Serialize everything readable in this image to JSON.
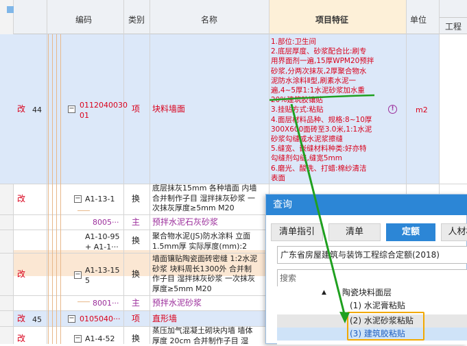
{
  "headers": {
    "code": "编码",
    "category": "类别",
    "name": "名称",
    "features": "项目特征",
    "unit": "单位",
    "engineering": "工程"
  },
  "row44": {
    "status": "改",
    "number": "44",
    "code": "011204003001",
    "code_line1": "0112040030",
    "code_line2": "01",
    "category": "项",
    "name": "块料墙面",
    "unit": "m2",
    "features": [
      "1.部位:卫生间",
      "2.底层厚度、砂浆配合比:刷专",
      "用界面剂一遍,15厚WPM20预拌",
      "砂浆,分两次抹灰,2厚聚合物水",
      "泥防水涂料Ⅱ型,刷素水泥一",
      "遍,4~5厚1:1水泥砂浆加水重",
      "20%建筑胶镶贴",
      "3.挂贴方式:粘贴",
      "4.面层材料品种、规格:8~10厚",
      "300X600面砖至3.0米,1:1水泥",
      "砂浆勾缝或水泥浆擦缝",
      "5.缝宽、嵌缝材料种类:好亦特",
      "勾缝剂勾缝,缝宽5mm",
      "6.磨光、酸洗、打蜡:棉纱清洁",
      "表面"
    ]
  },
  "sub1": {
    "status": "改",
    "code": "A1-13-1",
    "category": "换",
    "name_lines": [
      "底层抹灰15mm 各种墙面 内墙",
      "合并制作子目 湿拌抹灰砂浆 一",
      "次抹灰厚度≥5mm M20"
    ]
  },
  "mat1": {
    "code": "8005···",
    "category": "主",
    "name": "预拌水泥石灰砂浆"
  },
  "sub2": {
    "code_line1": "A1-10-95",
    "code_line2": "+ A1-1···",
    "category": "换",
    "name_lines": [
      "聚合物水泥(JS)防水涂料 立面",
      "1.5mm厚  实际厚度(mm):2"
    ]
  },
  "sub3": {
    "status": "改",
    "code_line1": "A1-13-15",
    "code_line2": "5",
    "category": "换",
    "name_lines": [
      "墙面镶贴陶瓷面砖密缝 1:2水泥",
      "砂浆 块料周长1300外  合并制",
      "作子目 湿拌抹灰砂浆 一次抹灰",
      "厚度≥5mm M20"
    ]
  },
  "mat2": {
    "code": "8001···",
    "category": "主",
    "name": "预拌水泥砂浆"
  },
  "row45": {
    "status": "改",
    "number": "45",
    "code": "0105040···",
    "category": "项",
    "name": "直形墙"
  },
  "sub4": {
    "status": "改",
    "code": "A1-4-52",
    "category": "换",
    "name_lines": [
      "蒸压加气混凝土砌块内墙 墙体",
      "厚度 20cm  合并制作子目 湿"
    ]
  },
  "dialog": {
    "title": "查询",
    "tabs": [
      "清单指引",
      "清单",
      "定额",
      "人材机"
    ],
    "active_tab": "定额",
    "quota_library": "广东省房屋建筑与装饰工程综合定额(2018)",
    "search_placeholder": "搜索",
    "tree": {
      "parent": "陶瓷块料面层",
      "items": [
        "(1) 水泥膏粘贴",
        "(2) 水泥砂浆粘贴",
        "(3) 建筑胶粘贴"
      ]
    }
  },
  "colors": {
    "accent": "#2c86d6",
    "annotation_green": "#1fa01f",
    "highlight_orange": "#f2a900",
    "modified_red": "#d9001b",
    "material_purple": "#9b2d9b"
  }
}
